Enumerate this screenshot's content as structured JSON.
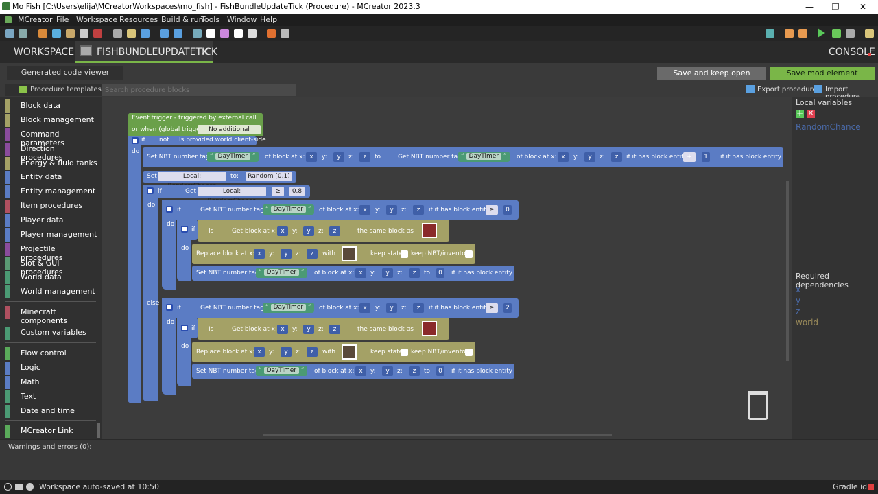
{
  "window": {
    "title": "Mo Fish [C:\\Users\\elija\\MCreatorWorkspaces\\mo_fish] - FishBundleUpdateTick (Procedure) - MCreator 2023.3",
    "min": "—",
    "max": "❐",
    "close": "✕"
  },
  "menu": [
    "MCreator",
    "File",
    "Workspace",
    "Resources",
    "Build & run",
    "Tools",
    "Window",
    "Help"
  ],
  "tabs": {
    "workspace": "WORKSPACE",
    "active": "FISHBUNDLEUPDATETICK",
    "close": "✕",
    "console": "CONSOLE"
  },
  "editor": {
    "code_viewer": "Generated code viewer",
    "save_open": "Save and keep open",
    "save_mod": "Save mod element",
    "templates": "Procedure templates",
    "search_placeholder": "Search procedure blocks",
    "export": "Export procedure",
    "import": "Import procedure"
  },
  "categories": [
    {
      "label": "Block data",
      "color": "#a4a166"
    },
    {
      "label": "Block management",
      "color": "#a4a166"
    },
    {
      "label": "Command parameters",
      "color": "#8a4c9c"
    },
    {
      "label": "Direction procedures",
      "color": "#8a4c9c"
    },
    {
      "label": "Energy & fluid tanks",
      "color": "#a4a166"
    },
    {
      "label": "Entity data",
      "color": "#5b7cc4"
    },
    {
      "label": "Entity management",
      "color": "#5b7cc4"
    },
    {
      "label": "Item procedures",
      "color": "#b05060"
    },
    {
      "label": "Player data",
      "color": "#5b7cc4"
    },
    {
      "label": "Player management",
      "color": "#5b7cc4"
    },
    {
      "label": "Projectile procedures",
      "color": "#8a4c9c"
    },
    {
      "label": "Slot & GUI procedures",
      "color": "#5b9a74"
    },
    {
      "label": "World data",
      "color": "#4b9a74"
    },
    {
      "label": "World management",
      "color": "#4b9a74"
    },
    {
      "label": "Minecraft components",
      "color": "#b05060"
    },
    {
      "label": "Custom variables",
      "color": "#4b9a74"
    },
    {
      "label": "Flow control",
      "color": "#5aaa5a"
    },
    {
      "label": "Logic",
      "color": "#5b7cc4"
    },
    {
      "label": "Math",
      "color": "#5b7cc4"
    },
    {
      "label": "Text",
      "color": "#4b9a74"
    },
    {
      "label": "Date and time",
      "color": "#4b9a74"
    },
    {
      "label": "MCreator Link",
      "color": "#5aaa5a"
    }
  ],
  "blocks": {
    "trigger1": "Event trigger - triggered by external call",
    "trigger2": "or when (global trigger):",
    "no_trigger": "No additional trigger",
    "if": "if",
    "not": "not",
    "client": "Is provided world client-side",
    "do": "do",
    "else": "else",
    "set_nbt": "Set NBT number tag",
    "get_nbt": "Get NBT number tag",
    "daytimer": "DayTimer",
    "of_block": "of block at x:",
    "y": "y:",
    "z": "z:",
    "to": "to",
    "has_entity": "if it has block entity",
    "var_x": "x",
    "var_y": "y",
    "var_z": "z",
    "plus": "+",
    "one": "1",
    "zero": "0",
    "two": "2",
    "gte": "≥",
    "set": "Set",
    "local": "Local: RandomChance",
    "to2": "to:",
    "random": "Random [0,1)",
    "get": "Get",
    "chance": "0.8",
    "is": "Is",
    "get_block": "Get block at x:",
    "same_block": "the same block as",
    "replace": "Replace block at x:",
    "with": "with",
    "keep_state": "keep state",
    "keep_nbt": "keep NBT/inventory"
  },
  "right": {
    "local_vars": "Local variables",
    "var1": "RandomChance",
    "deps": "Required dependencies",
    "dep_items": [
      "x",
      "y",
      "z",
      "world"
    ]
  },
  "bottom": {
    "warnings": "Warnings and errors (0):",
    "status": "Workspace auto-saved at 10:50",
    "gradle": "Gradle idle"
  }
}
